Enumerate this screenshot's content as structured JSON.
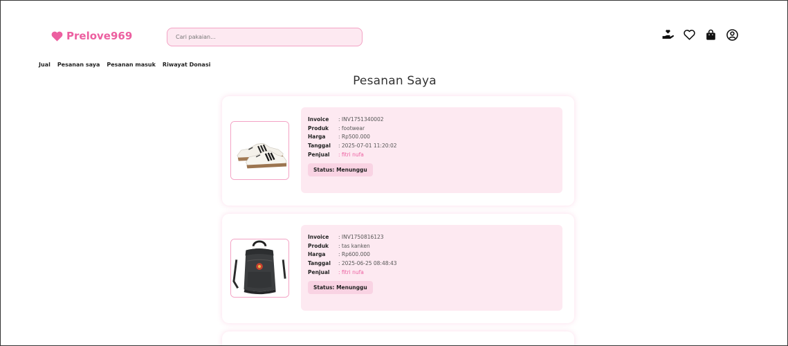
{
  "brand": {
    "name": "Prelove969",
    "color": "#ec5fa0"
  },
  "search": {
    "placeholder": "Cari pakaian..."
  },
  "header_icons": [
    "donate-hand-icon",
    "heart-icon",
    "shopping-bag-icon",
    "user-profile-icon"
  ],
  "nav": {
    "items": [
      "Jual",
      "Pesanan saya",
      "Pesanan masuk",
      "Riwayat Donasi"
    ]
  },
  "page": {
    "title": "Pesanan Saya"
  },
  "labels": {
    "invoice": "Invoice",
    "produk": "Produk",
    "harga": "Harga",
    "tanggal": "Tanggal",
    "penjual": "Penjual",
    "status": "Status:"
  },
  "orders": [
    {
      "invoice": ": INV1751340002",
      "produk": ": footwear",
      "harga": ": Rp500.000",
      "tanggal": ": 2025-07-01 11:20:02",
      "penjual": ": fitri nufa",
      "status": "Menunggu",
      "image": "sneaker-image"
    },
    {
      "invoice": ": INV1750816123",
      "produk": ": tas kanken",
      "harga": ": Rp600.000",
      "tanggal": ": 2025-06-25 08:48:43",
      "penjual": ": fitri nufa",
      "status": "Menunggu",
      "image": "backpack-image"
    }
  ]
}
